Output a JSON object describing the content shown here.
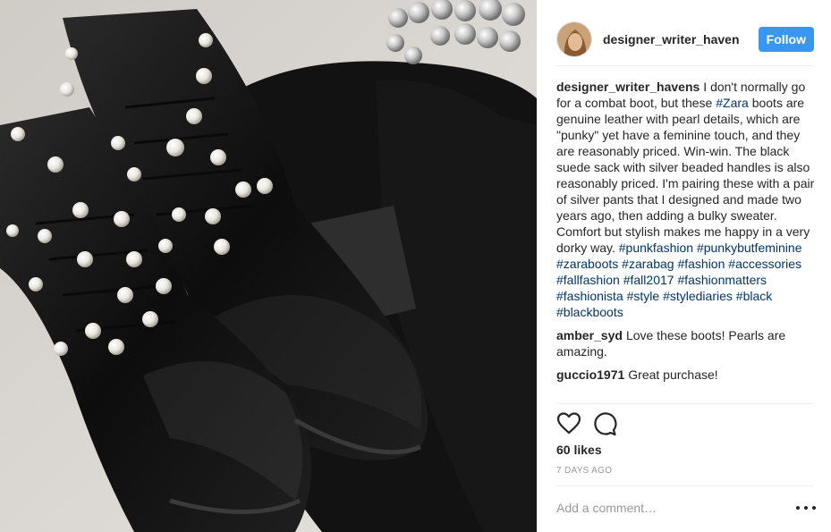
{
  "post": {
    "username": "designer_writer_havens",
    "follow_label": "Follow",
    "likes": "60 likes",
    "time": "7 DAYS AGO",
    "add_comment_placeholder": "Add a comment…"
  },
  "caption": {
    "username": "designer_writer_havens",
    "text1": "I don't normally go for a combat boot, but these ",
    "tag_zara": "#Zara",
    "text2": " boots are genuine leather with pearl details, which are \"punky\" yet have a feminine touch, and they are reasonably priced. Win-win. The black suede sack with silver beaded handles is also reasonably priced. I'm pairing these with a pair of silver pants that I designed and made two years ago, then adding a bulky sweater. Comfort but stylish makes me happy in a very dorky way. ",
    "hashtags": [
      "#punkfashion",
      "#punkybutfeminine",
      "#zaraboots",
      "#zarabag",
      "#fashion",
      "#accessories",
      "#fallfashion",
      "#fall2017",
      "#fashionmatters",
      "#fashionista",
      "#style",
      "#stylediaries",
      "#black",
      "#blackboots"
    ]
  },
  "comments": [
    {
      "username": "amber_syd",
      "text": "Love these boots! Pearls are amazing."
    },
    {
      "username": "guccio1971",
      "text": "Great purchase!"
    }
  ],
  "icons": {
    "like": "heart-icon",
    "comment": "comment-icon",
    "more": "more-options-icon"
  },
  "colors": {
    "follow_bg": "#3897f0",
    "hashtag": "#003569",
    "muted": "#999999"
  }
}
